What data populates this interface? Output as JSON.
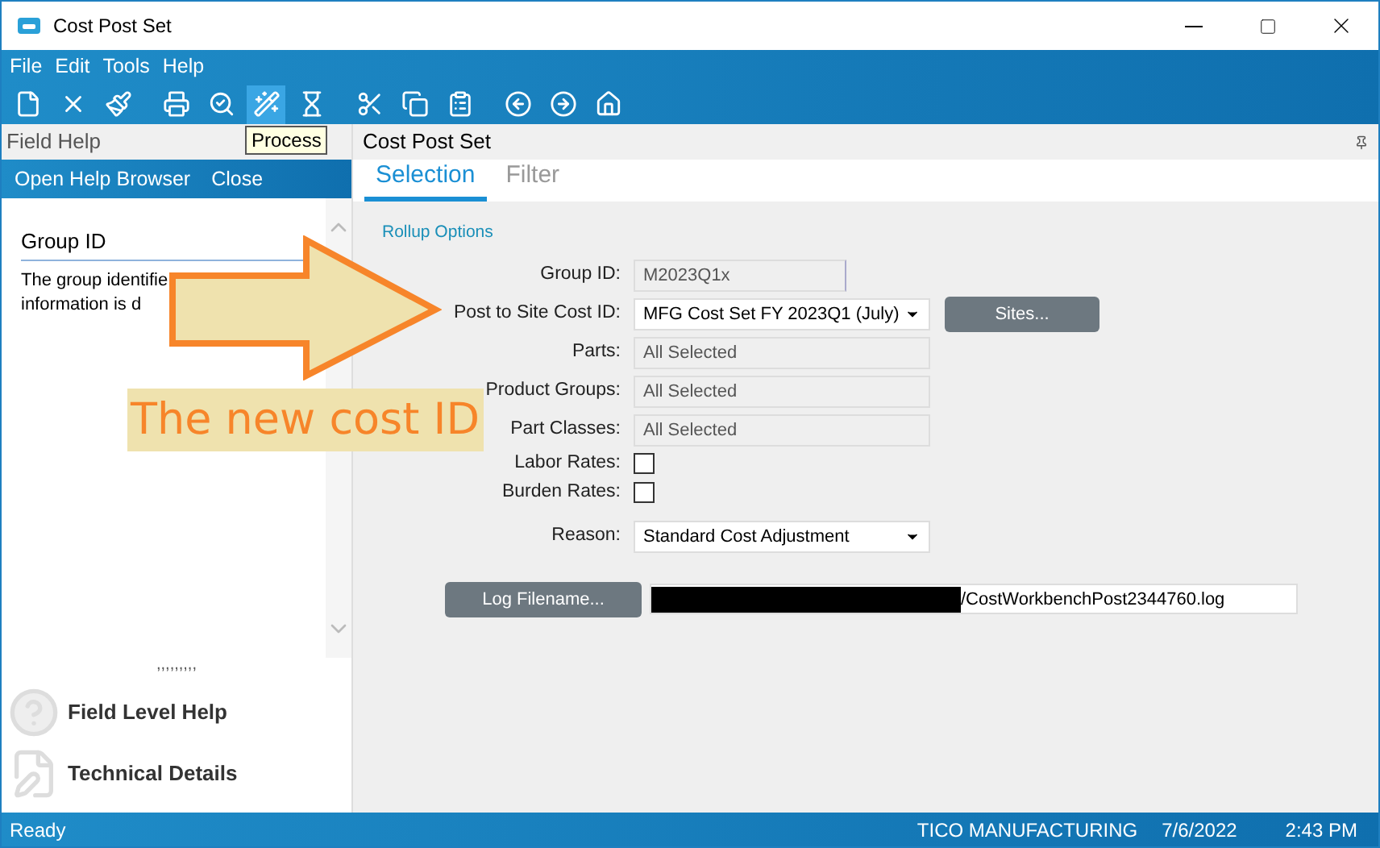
{
  "window": {
    "title": "Cost Post Set"
  },
  "menu": [
    "File",
    "Edit",
    "Tools",
    "Help"
  ],
  "toolbar": [
    {
      "kind": "new",
      "selected": false
    },
    {
      "kind": "delete",
      "selected": false
    },
    {
      "kind": "clear",
      "selected": false
    },
    {
      "kind": "print",
      "selected": false
    },
    {
      "kind": "preview",
      "selected": false
    },
    {
      "kind": "process",
      "selected": true
    },
    {
      "kind": "schedule",
      "selected": false
    },
    {
      "kind": "cut",
      "selected": false
    },
    {
      "kind": "copy",
      "selected": false
    },
    {
      "kind": "paste",
      "selected": false
    },
    {
      "kind": "back",
      "selected": false
    },
    {
      "kind": "forward",
      "selected": false
    },
    {
      "kind": "home",
      "selected": false
    }
  ],
  "tooltip": "Process",
  "field_help": {
    "title": "Field Help",
    "actions": [
      "Open Help Browser",
      "Close"
    ],
    "heading": "Group ID",
    "text_lines": [
      "The group identifie",
      "information is d"
    ],
    "grip": ",,,,,,,,,",
    "links": [
      {
        "kind": "help",
        "label": "Field Level Help"
      },
      {
        "kind": "tech",
        "label": "Technical Details"
      }
    ]
  },
  "main": {
    "title": "Cost Post Set",
    "tabs": [
      {
        "label": "Selection",
        "selected": true
      },
      {
        "label": "Filter",
        "selected": false
      }
    ],
    "section": "Rollup Options",
    "fields": [
      {
        "kind": "text",
        "label": "Group ID:",
        "value": "M2023Q1x"
      },
      {
        "kind": "combo",
        "label": "Post to Site Cost ID:",
        "value": "MFG Cost Set FY 2023Q1 (July)",
        "button": "Sites..."
      },
      {
        "kind": "readonly",
        "label": "Parts:",
        "value": "All Selected"
      },
      {
        "kind": "readonly",
        "label": "Product Groups:",
        "value": "All Selected"
      },
      {
        "kind": "readonly",
        "label": "Part Classes:",
        "value": "All Selected"
      },
      {
        "kind": "check",
        "label": "Labor Rates:",
        "checked": false
      },
      {
        "kind": "check",
        "label": "Burden Rates:",
        "checked": false
      },
      {
        "kind": "combo",
        "label": "Reason:",
        "value": "Standard Cost Adjustment"
      }
    ],
    "log": {
      "button": "Log Filename...",
      "value": "/CostWorkbenchPost2344760.log"
    }
  },
  "annotation": {
    "caption": "The new cost ID"
  },
  "status_bar": {
    "state": "Ready",
    "company": "TICO MANUFACTURING",
    "date": "7/6/2022",
    "time": "2:43 PM"
  }
}
